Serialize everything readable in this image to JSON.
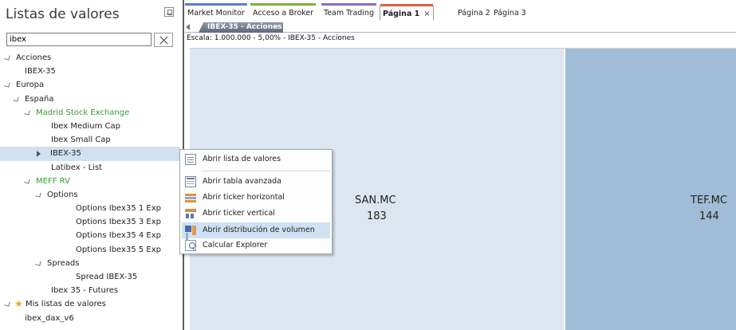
{
  "left_panel": {
    "title": "Listas de valores",
    "search": {
      "value": "ibex",
      "placeholder": ""
    },
    "tree": [
      {
        "label": "Acciones",
        "depth": 0,
        "state": "expanded"
      },
      {
        "label": "IBEX-35",
        "depth": 1,
        "state": "leaf"
      },
      {
        "label": "Europa",
        "depth": 0,
        "state": "expanded"
      },
      {
        "label": "España",
        "depth": 1,
        "state": "expanded"
      },
      {
        "label": "Madrid Stock Exchange",
        "depth": 2,
        "state": "expanded",
        "color": "green"
      },
      {
        "label": "Ibex Medium Cap",
        "depth": 3,
        "state": "leaf"
      },
      {
        "label": "Ibex Small Cap",
        "depth": 3,
        "state": "leaf"
      },
      {
        "label": "IBEX-35",
        "depth": 3,
        "state": "collapsed",
        "selected": true
      },
      {
        "label": "Latibex - List",
        "depth": 3,
        "state": "leaf"
      },
      {
        "label": "MEFF RV",
        "depth": 2,
        "state": "expanded",
        "color": "green"
      },
      {
        "label": "Options",
        "depth": 3,
        "state": "expanded"
      },
      {
        "label": "Options Ibex35 1 Exp",
        "depth": 4,
        "state": "leaf"
      },
      {
        "label": "Options Ibex35 3 Exp",
        "depth": 4,
        "state": "leaf"
      },
      {
        "label": "Options Ibex35 4 Exp",
        "depth": 4,
        "state": "leaf"
      },
      {
        "label": "Options Ibex35 5 Exp",
        "depth": 4,
        "state": "leaf"
      },
      {
        "label": "Spreads",
        "depth": 3,
        "state": "expanded"
      },
      {
        "label": "Spread IBEX-35",
        "depth": 4,
        "state": "leaf"
      },
      {
        "label": "Ibex 35 - Futures",
        "depth": 3,
        "state": "leaf"
      },
      {
        "label": "Mis listas de valores",
        "depth": 0,
        "state": "expanded",
        "icon": "star-icon"
      },
      {
        "label": "ibex_dax_v6",
        "depth": 1,
        "state": "leaf"
      }
    ]
  },
  "tabs": [
    {
      "label": "Market Monitor",
      "color": "#5b7fc0"
    },
    {
      "label": "Acceso a Broker",
      "color": "#7fb03a"
    },
    {
      "label": "Team Trading",
      "color": "#8e6cc0"
    },
    {
      "label": "Página 1",
      "color": "#e06040",
      "active": true
    },
    {
      "label": "Página 2",
      "color": ""
    },
    {
      "label": "Página 3",
      "color": ""
    }
  ],
  "tab_close_glyph": "×",
  "document_tab": {
    "label": "IBEX-35 - Acciones",
    "close_glyph": "×"
  },
  "chart": {
    "scale_label": "Escala: 1.000.000 - 5,00% - IBEX-35 - Acciones",
    "tiles": [
      {
        "ticker": "SAN.MC",
        "value": "183",
        "color": "#dce6f1"
      },
      {
        "ticker": "TEF.MC",
        "value": "144",
        "color": "#a0bcd7"
      }
    ]
  },
  "context_menu": {
    "items": [
      {
        "label": "Abrir lista de valores",
        "icon": "list-icon"
      },
      {
        "label": "Abrir tabla avanzada",
        "icon": "table-icon"
      },
      {
        "label": "Abrir ticker horizontal",
        "icon": "horizontal-ticker-icon"
      },
      {
        "label": "Abrir ticker vertical",
        "icon": "vertical-ticker-icon"
      },
      {
        "label": "Abrir distribución de volumen",
        "icon": "volume-distribution-icon",
        "highlighted": true
      },
      {
        "label": "Calcular Explorer",
        "icon": "explorer-icon"
      }
    ]
  },
  "colors": {
    "selection": "#cfe1f2",
    "green_node": "#33a033",
    "divider": "#5f5f5f"
  }
}
